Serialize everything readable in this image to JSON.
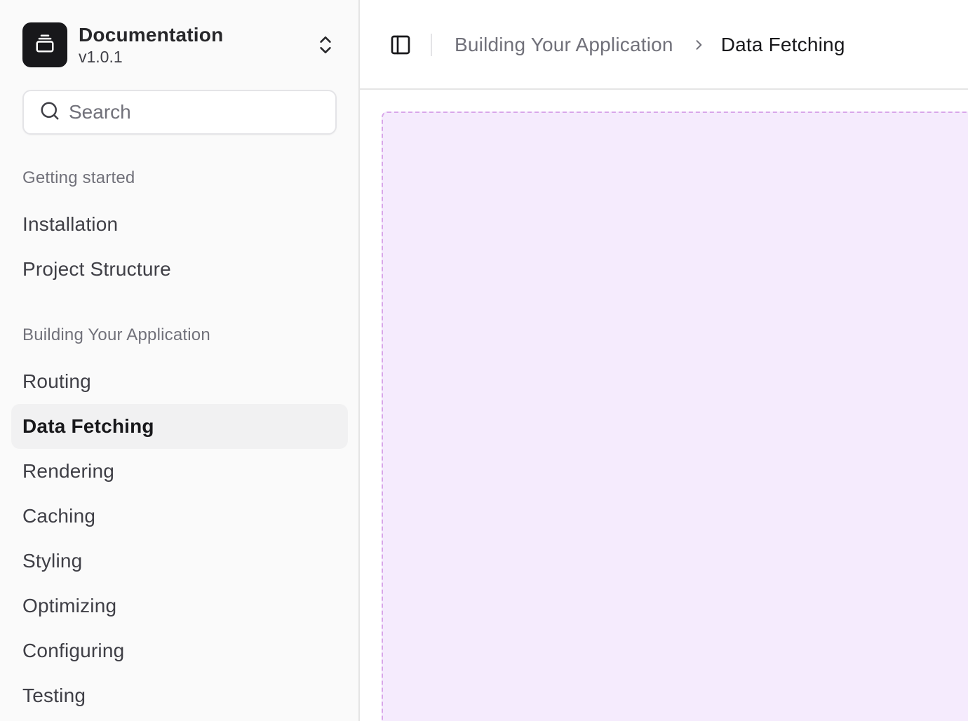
{
  "team": {
    "name": "Documentation",
    "version": "v1.0.1",
    "logo_icon": "stack-icon",
    "switch_icon": "chevrons-up-down-icon"
  },
  "search": {
    "placeholder": "Search",
    "icon": "search-icon"
  },
  "sidebar": {
    "groups": [
      {
        "label": "Getting started",
        "items": [
          {
            "label": "Installation"
          },
          {
            "label": "Project Structure"
          }
        ]
      },
      {
        "label": "Building Your Application",
        "items": [
          {
            "label": "Routing"
          },
          {
            "label": "Data Fetching",
            "active": true
          },
          {
            "label": "Rendering"
          },
          {
            "label": "Caching"
          },
          {
            "label": "Styling"
          },
          {
            "label": "Optimizing"
          },
          {
            "label": "Configuring"
          },
          {
            "label": "Testing"
          }
        ]
      }
    ]
  },
  "header": {
    "toggle_icon": "panel-left-icon",
    "breadcrumb": {
      "parent": "Building Your Application",
      "separator_icon": "chevron-right-icon",
      "current": "Data Fetching"
    }
  },
  "colors": {
    "placeholder_fill": "#f5ebfd",
    "placeholder_border": "#d8a6ea",
    "active_item_bg": "#f1f1f2",
    "logo_bg": "#18181b"
  }
}
